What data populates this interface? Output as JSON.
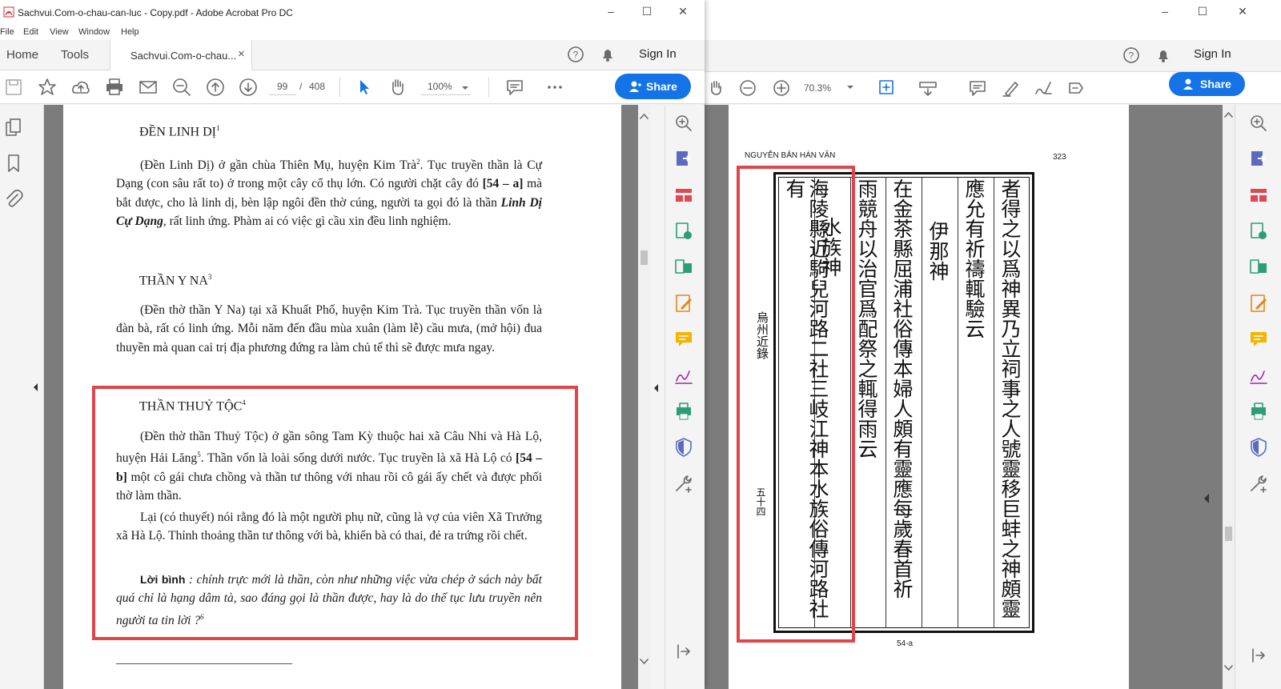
{
  "app": {
    "window_title": "Sachvui.Com-o-chau-can-luc - Copy.pdf - Adobe Acrobat Pro DC",
    "menu": [
      "File",
      "Edit",
      "View",
      "Window",
      "Help"
    ],
    "tabs": {
      "home": "Home",
      "tools": "Tools",
      "document": "Sachvui.Com-o-chau...",
      "close": "×"
    },
    "sign_in": "Sign In",
    "share": "Share",
    "page_current": "99",
    "page_separator": "/",
    "page_total": "408",
    "zoom": "100%"
  },
  "right_app": {
    "sign_in": "Sign In",
    "share": "Share",
    "zoom": "70.3%"
  },
  "left_page": {
    "heading1": "ĐỀN LINH DỊ",
    "heading1_sup": "1",
    "para1_a": "(Đền Linh Dị) ở gần chùa Thiên Mụ, huyện Kim Trà",
    "para1_sup": "2",
    "para1_b": ". Tục truyền thần là Cự Dạng (con sâu rất to) ở trong một cây cổ thụ lớn. Có người chặt cây đó ",
    "para1_ref": "[54 – a]",
    "para1_c": " mà bắt được, cho là linh dị, bèn lập ngôi đền thờ cúng, người ta gọi đó là thần ",
    "para1_em": "Linh Dị Cự Dạng",
    "para1_d": ", rất linh ứng. Phàm ai có việc gì cầu xin đều linh nghiệm.",
    "heading2": "THẦN Y NA",
    "heading2_sup": "3",
    "para2": "(Đền thờ thần Y Na) tại xã Khuất Phố, huyện Kim Trà. Tục truyền thần vốn là đàn bà, rất có linh ứng. Mỗi năm đến đầu mùa xuân (làm lễ) cầu mưa, (mở hội) đua thuyền mà quan cai trị địa phương đứng ra làm chủ tế thì sẽ được mưa ngay.",
    "heading3": "THẦN THUỶ TỘC",
    "heading3_sup": "4",
    "para3_a": "(Đền thờ thần Thuỷ Tộc) ở gần sông Tam Kỳ thuộc hai xã Câu Nhi và Hà Lộ, huyện Hải Lăng",
    "para3_sup": "5",
    "para3_b": ". Thần vốn là loài sống dưới nước. Tục truyền là xã Hà Lộ có ",
    "para3_ref": "[54 – b]",
    "para3_c": " một cô gái chưa chồng và thần tư thông với nhau rồi cô gái ấy chết và được phối thờ làm thần.",
    "para4": "Lại (có thuyết) nói rằng đó là một người phụ nữ, cũng là vợ của viên Xã Trưởng xã Hà Lộ. Thỉnh thoảng thần tư thông với bà, khiến bà có thai, đẻ ra trứng rồi chết.",
    "para5_label": "Lời bình",
    "para5": " : chính trực mới là thần, còn như những việc vừa chép ở sách này bất quá chỉ là hạng dâm tà, sao đáng gọi là thần được, hay là do thế tục lưu truyền nên người ta tin lời ?",
    "para5_sup": "6"
  },
  "right_page": {
    "header_left": "NGUYỄN BẢN HÁN VĂN",
    "page_number": "323",
    "footer": "54-a",
    "side_title": "烏州近錄",
    "side_number": "五十四",
    "columns": [
      "海陵縣近駒兒河路二社三岐江神本水族俗傳河路社有",
      "水族神",
      "雨競舟以治官爲配祭之輒得雨云",
      "在金茶縣屈浦社俗傳本婦人頗有靈應每歲春首祈",
      "伊那神",
      "應允有祈禱輒驗云",
      "者得之以爲神異乃立祠事之人號靈移巨蚌之神頗靈"
    ]
  },
  "colors": {
    "accent": "#1473e6",
    "highlight": "#e0454b"
  }
}
